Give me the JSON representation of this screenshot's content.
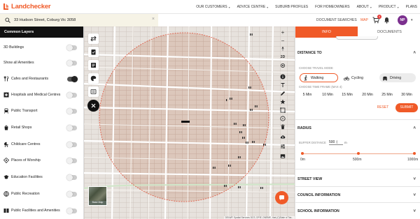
{
  "brand": {
    "name": "Landchecker",
    "accent": "#f05a28"
  },
  "nav": {
    "items": [
      {
        "label": "OUR CUSTOMERS",
        "caret": true
      },
      {
        "label": "ADVICE CENTRE",
        "caret": true
      },
      {
        "label": "SUBURB PROFILES",
        "caret": false
      },
      {
        "label": "FOR HOMEOWNERS",
        "caret": false
      },
      {
        "label": "ABOUT",
        "caret": true
      },
      {
        "label": "PRODUCT",
        "caret": true
      },
      {
        "label": "PLANS",
        "caret": false
      }
    ],
    "caret_glyph": "▾"
  },
  "search": {
    "value": "33 Hudson Street, Coburg Vic 3058",
    "clear_glyph": "×"
  },
  "toolbar": {
    "documents_label": "DOCUMENT SEARCHES",
    "map_label": "MAP",
    "cart_count": "4",
    "avatar_initials": "NP",
    "avatar_caret": "▾"
  },
  "layers": {
    "title": "Common Layers",
    "items": [
      {
        "label": "3D Buildings",
        "icon": "",
        "on": false
      },
      {
        "label": "Show all Amenities",
        "icon": "",
        "on": false
      },
      {
        "label": "Cafes and Restaurants",
        "icon": "cafe-icon",
        "on": true
      },
      {
        "label": "Hospitals and Medical Centres",
        "icon": "hospital-icon",
        "on": false
      },
      {
        "label": "Public Transport",
        "icon": "train-icon",
        "on": false
      },
      {
        "label": "Retail Shops",
        "icon": "shop-icon",
        "on": false
      },
      {
        "label": "Childcare Centres",
        "icon": "childcare-icon",
        "on": false
      },
      {
        "label": "Places of Worship",
        "icon": "worship-icon",
        "on": false
      },
      {
        "label": "Education Facilities",
        "icon": "education-icon",
        "on": false
      },
      {
        "label": "Public Recreation",
        "icon": "recreation-icon",
        "on": false
      },
      {
        "label": "Public Facilities and Amenities",
        "icon": "facilities-icon",
        "on": false
      }
    ]
  },
  "map": {
    "zoom_in": "+",
    "zoom_out": "−",
    "mode_2d": "2D",
    "basemap_label": "Base Map",
    "attribution": "DELWP, Spatial Services DCS, DPIE, DNRME, that (C)State of Tas...",
    "radius_color": "#e0523a"
  },
  "panel": {
    "tabs": {
      "info": "INFO",
      "documents": "DOCUMENTS"
    },
    "distance": {
      "title": "DISTANCE TO",
      "chevron": "˄",
      "mode_label": "CHOOSE TRAVEL MODE",
      "modes": [
        {
          "label": "Walking",
          "icon": "walking-icon",
          "selected": true
        },
        {
          "label": "Cycling",
          "icon": "cycling-icon",
          "selected": false
        },
        {
          "label": "Driving",
          "icon": "car-icon",
          "selected": false
        }
      ],
      "time_label": "CHOOSE TIME FRAME (MAX 4)",
      "times": [
        "5 Min",
        "10 Min",
        "15 Min",
        "20 Min",
        "25 Min",
        "30 Min"
      ],
      "reset": "RESET",
      "submit": "SUBMIT"
    },
    "radius": {
      "title": "RADIUS",
      "chevron": "˄",
      "buffer_label": "BUFFER DISTANCE",
      "buffer_value": "500",
      "buffer_unit": "m",
      "spin_up": "▴",
      "spin_down": "▾",
      "slider_min": "0m",
      "slider_mid": "500m",
      "slider_max": "1000m",
      "slider_value_fraction": 0.5
    },
    "street_view": {
      "title": "STREET VIEW",
      "chevron": "˅"
    },
    "council": {
      "title": "COUNCIL INFORMATION",
      "chevron": "˅"
    },
    "school": {
      "title": "SCHOOL INFORMATION",
      "chevron": "˅"
    }
  }
}
